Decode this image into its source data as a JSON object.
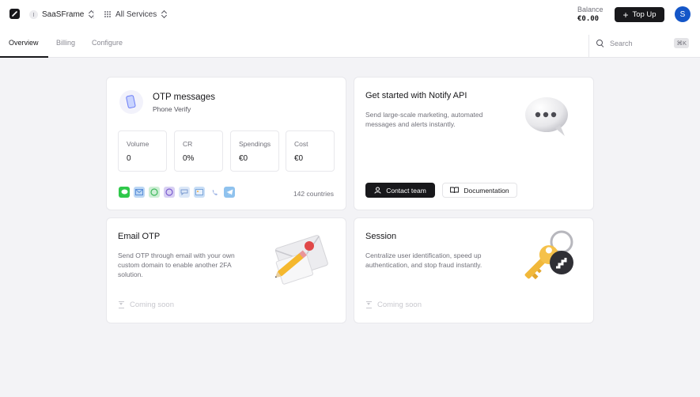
{
  "header": {
    "workspace": "SaaSFrame",
    "services": "All Services",
    "balance_label": "Balance",
    "balance_value": "€0.00",
    "topup_label": "Top Up",
    "avatar_initial": "S"
  },
  "tabs": [
    {
      "label": "Overview",
      "active": true
    },
    {
      "label": "Billing",
      "active": false
    },
    {
      "label": "Configure",
      "active": false
    }
  ],
  "search": {
    "placeholder": "Search",
    "shortcut": "⌘K"
  },
  "otp_card": {
    "title": "OTP messages",
    "subtitle": "Phone Verify",
    "stats": [
      {
        "label": "Volume",
        "value": "0"
      },
      {
        "label": "CR",
        "value": "0%"
      },
      {
        "label": "Spendings",
        "value": "€0"
      },
      {
        "label": "Cost",
        "value": "€0"
      }
    ],
    "channel_icons": [
      "imessage-icon",
      "email-icon",
      "whatsapp-icon",
      "viber-icon",
      "sms-icon",
      "gallery-icon",
      "phone-icon",
      "telegram-icon"
    ],
    "countries": "142 countries"
  },
  "notify_card": {
    "title": "Get started with Notify API",
    "description": "Send large-scale marketing, automated messages and alerts instantly.",
    "contact_label": "Contact team",
    "docs_label": "Documentation"
  },
  "email_card": {
    "title": "Email OTP",
    "description": "Send OTP through email with your own custom domain to enable another 2FA solution.",
    "status": "Coming soon"
  },
  "session_card": {
    "title": "Session",
    "description": "Centralize user identification, speed up authentication, and stop fraud instantly.",
    "status": "Coming soon"
  },
  "colors": {
    "accent": "#18181b",
    "avatar": "#1456c8",
    "background": "#f3f3f6"
  }
}
